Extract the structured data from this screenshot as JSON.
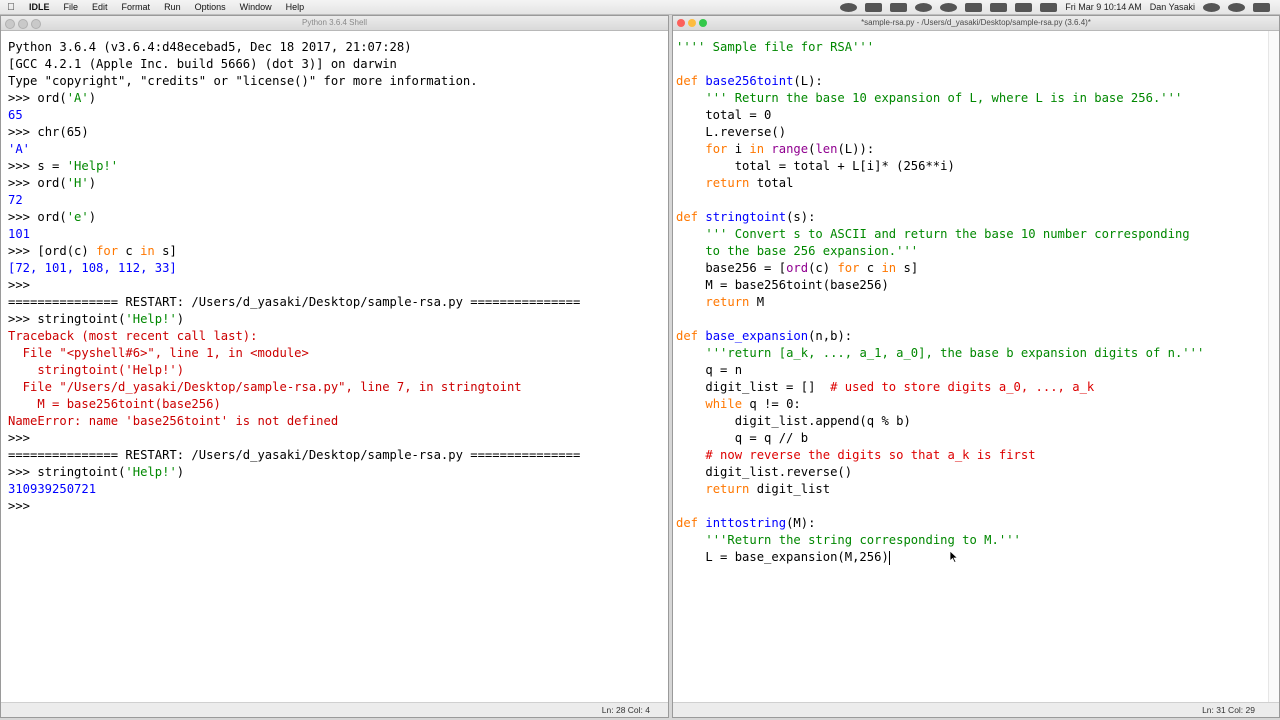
{
  "menubar": {
    "app_name": "IDLE",
    "menus": [
      "File",
      "Edit",
      "Format",
      "Run",
      "Options",
      "Window",
      "Help"
    ],
    "datetime": "Fri Mar 9  10:14 AM",
    "user": "Dan Yasaki"
  },
  "shell": {
    "title": "Python 3.6.4 Shell",
    "lines": [
      [
        {
          "t": "Python 3.6.4 (v3.6.4:d48ecebad5, Dec 18 2017, 21:07:28)",
          "c": "norm"
        }
      ],
      [
        {
          "t": "[GCC 4.2.1 (Apple Inc. build 5666) (dot 3)] on darwin",
          "c": "norm"
        }
      ],
      [
        {
          "t": "Type \"copyright\", \"credits\" or \"license()\" for more information.",
          "c": "norm"
        }
      ],
      [
        {
          "t": ">>> ",
          "c": "norm"
        },
        {
          "t": "ord(",
          "c": "norm"
        },
        {
          "t": "'A'",
          "c": "str"
        },
        {
          "t": ")",
          "c": "norm"
        }
      ],
      [
        {
          "t": "65",
          "c": "out"
        }
      ],
      [
        {
          "t": ">>> ",
          "c": "norm"
        },
        {
          "t": "chr(65)",
          "c": "norm"
        }
      ],
      [
        {
          "t": "'A'",
          "c": "out"
        }
      ],
      [
        {
          "t": ">>> ",
          "c": "norm"
        },
        {
          "t": "s = ",
          "c": "norm"
        },
        {
          "t": "'Help!'",
          "c": "str"
        }
      ],
      [
        {
          "t": ">>> ",
          "c": "norm"
        },
        {
          "t": "ord(",
          "c": "norm"
        },
        {
          "t": "'H'",
          "c": "str"
        },
        {
          "t": ")",
          "c": "norm"
        }
      ],
      [
        {
          "t": "72",
          "c": "out"
        }
      ],
      [
        {
          "t": ">>> ",
          "c": "norm"
        },
        {
          "t": "ord(",
          "c": "norm"
        },
        {
          "t": "'e'",
          "c": "str"
        },
        {
          "t": ")",
          "c": "norm"
        }
      ],
      [
        {
          "t": "101",
          "c": "out"
        }
      ],
      [
        {
          "t": ">>> ",
          "c": "norm"
        },
        {
          "t": "[ord(c) ",
          "c": "norm"
        },
        {
          "t": "for",
          "c": "kw"
        },
        {
          "t": " c ",
          "c": "norm"
        },
        {
          "t": "in",
          "c": "kw"
        },
        {
          "t": " s]",
          "c": "norm"
        }
      ],
      [
        {
          "t": "[72, 101, 108, 112, 33]",
          "c": "out"
        }
      ],
      [
        {
          "t": ">>> ",
          "c": "norm"
        }
      ],
      [
        {
          "t": "=============== RESTART: /Users/d_yasaki/Desktop/sample-rsa.py ===============",
          "c": "norm"
        }
      ],
      [
        {
          "t": ">>> ",
          "c": "norm"
        },
        {
          "t": "stringtoint(",
          "c": "norm"
        },
        {
          "t": "'Help!'",
          "c": "str"
        },
        {
          "t": ")",
          "c": "norm"
        }
      ],
      [
        {
          "t": "Traceback (most recent call last):",
          "c": "err"
        }
      ],
      [
        {
          "t": "  File \"<pyshell#6>\", line 1, in <module>",
          "c": "err"
        }
      ],
      [
        {
          "t": "    stringtoint('Help!')",
          "c": "err"
        }
      ],
      [
        {
          "t": "  File \"/Users/d_yasaki/Desktop/sample-rsa.py\", line 7, in stringtoint",
          "c": "err"
        }
      ],
      [
        {
          "t": "    M = base256toint(base256)",
          "c": "err"
        }
      ],
      [
        {
          "t": "NameError: name 'base256toint' is not defined",
          "c": "err"
        }
      ],
      [
        {
          "t": ">>> ",
          "c": "norm"
        }
      ],
      [
        {
          "t": "=============== RESTART: /Users/d_yasaki/Desktop/sample-rsa.py ===============",
          "c": "norm"
        }
      ],
      [
        {
          "t": ">>> ",
          "c": "norm"
        },
        {
          "t": "stringtoint(",
          "c": "norm"
        },
        {
          "t": "'Help!'",
          "c": "str"
        },
        {
          "t": ")",
          "c": "norm"
        }
      ],
      [
        {
          "t": "310939250721",
          "c": "out"
        }
      ],
      [
        {
          "t": ">>> ",
          "c": "norm"
        }
      ]
    ],
    "status": "Ln: 28  Col: 4"
  },
  "editor": {
    "title": "*sample-rsa.py - /Users/d_yasaki/Desktop/sample-rsa.py (3.6.4)*",
    "lines": [
      [
        {
          "t": "'''' Sample file for RSA'''",
          "c": "str"
        }
      ],
      [],
      [
        {
          "t": "def",
          "c": "kw"
        },
        {
          "t": " ",
          "c": "norm"
        },
        {
          "t": "base256toint",
          "c": "def"
        },
        {
          "t": "(L):",
          "c": "norm"
        }
      ],
      [
        {
          "t": "    ",
          "c": "norm"
        },
        {
          "t": "''' Return the base 10 expansion of L, where L is in base 256.'''",
          "c": "str"
        }
      ],
      [
        {
          "t": "    total = 0",
          "c": "norm"
        }
      ],
      [
        {
          "t": "    L.reverse()",
          "c": "norm"
        }
      ],
      [
        {
          "t": "    ",
          "c": "norm"
        },
        {
          "t": "for",
          "c": "kw"
        },
        {
          "t": " i ",
          "c": "norm"
        },
        {
          "t": "in",
          "c": "kw"
        },
        {
          "t": " ",
          "c": "norm"
        },
        {
          "t": "range",
          "c": "blt"
        },
        {
          "t": "(",
          "c": "norm"
        },
        {
          "t": "len",
          "c": "blt"
        },
        {
          "t": "(L)):",
          "c": "norm"
        }
      ],
      [
        {
          "t": "        total = total + L[i]* (256**i)",
          "c": "norm"
        }
      ],
      [
        {
          "t": "    ",
          "c": "norm"
        },
        {
          "t": "return",
          "c": "kw"
        },
        {
          "t": " total",
          "c": "norm"
        }
      ],
      [],
      [
        {
          "t": "def",
          "c": "kw"
        },
        {
          "t": " ",
          "c": "norm"
        },
        {
          "t": "stringtoint",
          "c": "def"
        },
        {
          "t": "(s):",
          "c": "norm"
        }
      ],
      [
        {
          "t": "    ",
          "c": "norm"
        },
        {
          "t": "''' Convert s to ASCII and return the base 10 number corresponding",
          "c": "str"
        }
      ],
      [
        {
          "t": "    to the base 256 expansion.'''",
          "c": "str"
        }
      ],
      [
        {
          "t": "    base256 = [",
          "c": "norm"
        },
        {
          "t": "ord",
          "c": "blt"
        },
        {
          "t": "(c) ",
          "c": "norm"
        },
        {
          "t": "for",
          "c": "kw"
        },
        {
          "t": " c ",
          "c": "norm"
        },
        {
          "t": "in",
          "c": "kw"
        },
        {
          "t": " s]",
          "c": "norm"
        }
      ],
      [
        {
          "t": "    M = base256toint(base256)",
          "c": "norm"
        }
      ],
      [
        {
          "t": "    ",
          "c": "norm"
        },
        {
          "t": "return",
          "c": "kw"
        },
        {
          "t": " M",
          "c": "norm"
        }
      ],
      [],
      [
        {
          "t": "def",
          "c": "kw"
        },
        {
          "t": " ",
          "c": "norm"
        },
        {
          "t": "base_expansion",
          "c": "def"
        },
        {
          "t": "(n,b):",
          "c": "norm"
        }
      ],
      [
        {
          "t": "    ",
          "c": "norm"
        },
        {
          "t": "'''return [a_k, ..., a_1, a_0], the base b expansion digits of n.'''",
          "c": "str"
        }
      ],
      [
        {
          "t": "    q = n",
          "c": "norm"
        }
      ],
      [
        {
          "t": "    digit_list = []  ",
          "c": "norm"
        },
        {
          "t": "# used to store digits a_0, ..., a_k",
          "c": "com"
        }
      ],
      [
        {
          "t": "    ",
          "c": "norm"
        },
        {
          "t": "while",
          "c": "kw"
        },
        {
          "t": " q != 0:",
          "c": "norm"
        }
      ],
      [
        {
          "t": "        digit_list.append(q % b)",
          "c": "norm"
        }
      ],
      [
        {
          "t": "        q = q // b",
          "c": "norm"
        }
      ],
      [
        {
          "t": "    ",
          "c": "norm"
        },
        {
          "t": "# now reverse the digits so that a_k is first",
          "c": "com"
        }
      ],
      [
        {
          "t": "    digit_list.reverse()",
          "c": "norm"
        }
      ],
      [
        {
          "t": "    ",
          "c": "norm"
        },
        {
          "t": "return",
          "c": "kw"
        },
        {
          "t": " digit_list",
          "c": "norm"
        }
      ],
      [],
      [
        {
          "t": "def",
          "c": "kw"
        },
        {
          "t": " ",
          "c": "norm"
        },
        {
          "t": "inttostring",
          "c": "def"
        },
        {
          "t": "(M):",
          "c": "norm"
        }
      ],
      [
        {
          "t": "    ",
          "c": "norm"
        },
        {
          "t": "'''Return the string corresponding to M.'''",
          "c": "str"
        }
      ],
      [
        {
          "t": "    L = base_expansion(M,256)",
          "c": "norm"
        }
      ]
    ],
    "status": "Ln: 31  Col: 29"
  }
}
